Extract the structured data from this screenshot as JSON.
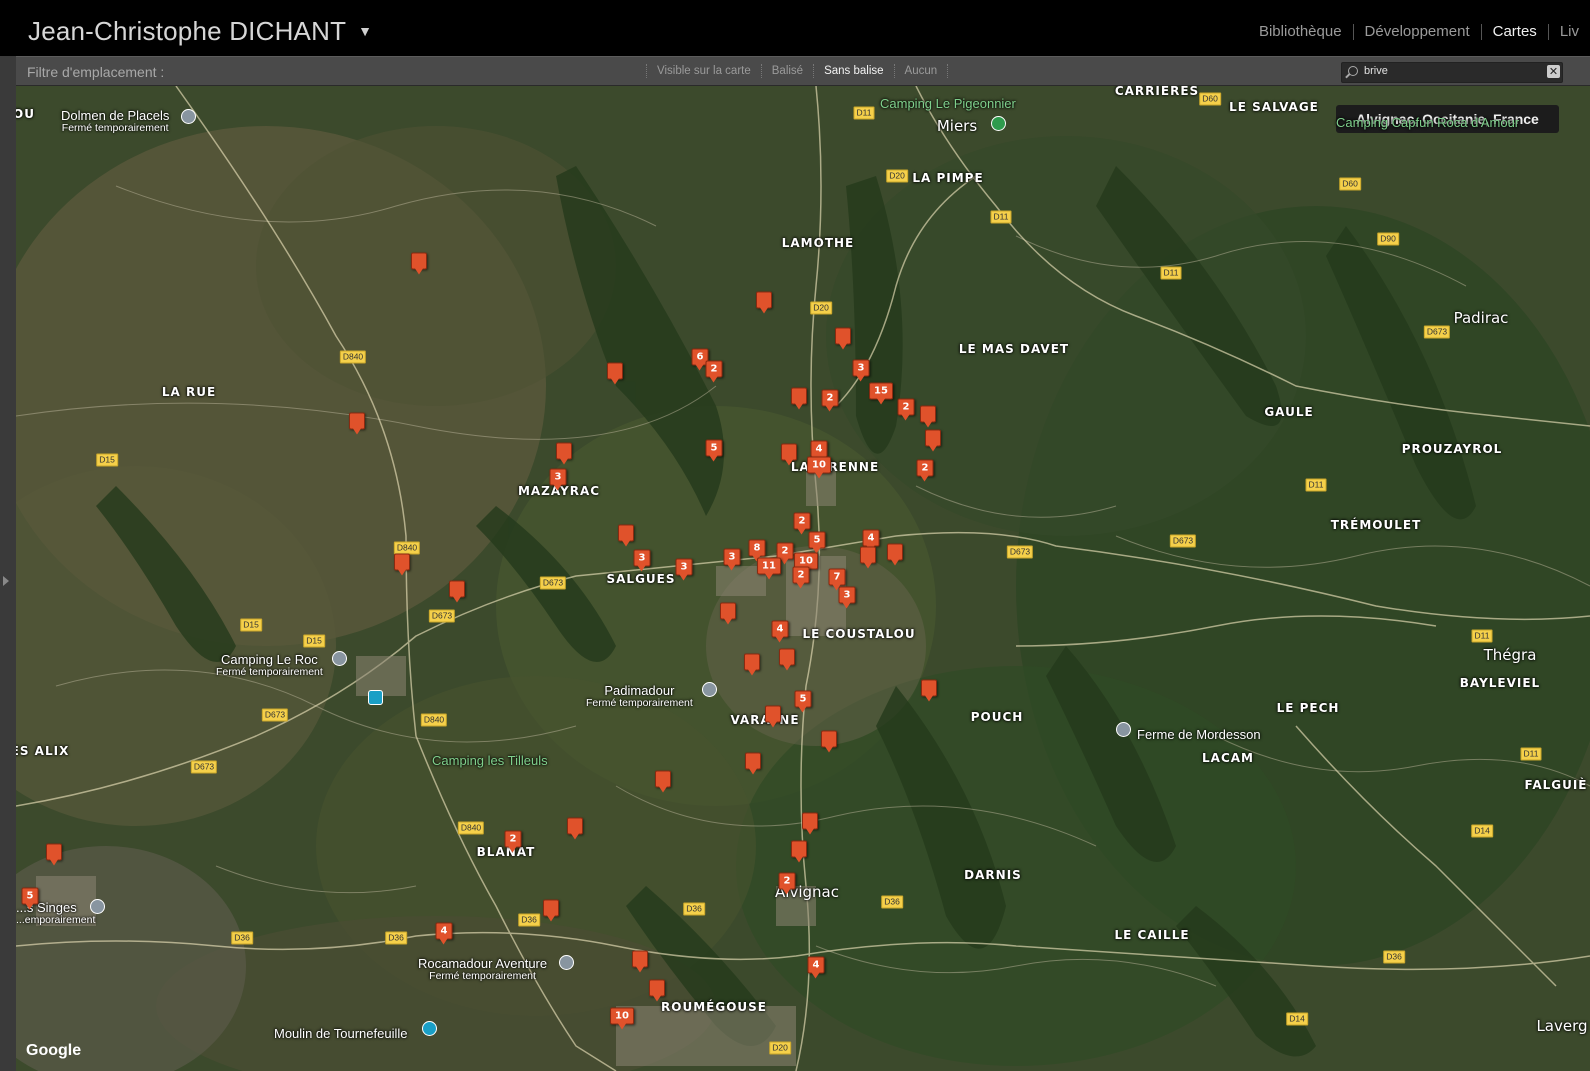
{
  "header": {
    "identity": "Jean-Christophe DICHANT",
    "modules": [
      {
        "label": "Bibliothèque",
        "active": false
      },
      {
        "label": "Développement",
        "active": false
      },
      {
        "label": "Cartes",
        "active": true
      },
      {
        "label": "Liv",
        "active": false
      }
    ]
  },
  "filter": {
    "label": "Filtre d'emplacement :",
    "options": [
      {
        "label": "Visible sur la carte",
        "selected": false
      },
      {
        "label": "Balisé",
        "selected": false
      },
      {
        "label": "Sans balise",
        "selected": true
      },
      {
        "label": "Aucun",
        "selected": false
      }
    ],
    "search_value": "brive",
    "clear_label": "✕"
  },
  "map": {
    "location_tooltip": "Alvignac, Occitanie, France",
    "attribution": "Google",
    "places": [
      "CARRIERES",
      "LE SALVAGE",
      "LA PIMPE",
      "LAMOTHE",
      "LE MAS DAVET",
      "GAULE",
      "PROUZAYROL",
      "TRÉMOULET",
      "LA RUE",
      "MAZAYRAC",
      "LAVERENNE",
      "SALGUES",
      "LE COUSTALOU",
      "VARAYNE",
      "POUCH",
      "LE PECH",
      "LACAM",
      "BAYLEVIEL",
      "FALGUIÈ",
      "ES ALIX",
      "BLANAT",
      "DARNIS",
      "LE CAILLE",
      "ROUMÉGOUSE",
      "OU"
    ],
    "towns": [
      "Miers",
      "Padirac",
      "Thégra",
      "Alvignac",
      "Laverg"
    ],
    "pois": [
      {
        "name": "Dolmen de Placels",
        "sub": "Fermé temporairement"
      },
      {
        "name": "Camping Le Pigeonnier",
        "sub": ""
      },
      {
        "name": "Camping Capfun Roca d'Amour",
        "sub": ""
      },
      {
        "name": "Camping Le Roc",
        "sub": "Fermé temporairement"
      },
      {
        "name": "Padimadour",
        "sub": "Fermé temporairement"
      },
      {
        "name": "Camping les Tilleuls",
        "sub": ""
      },
      {
        "name": "Ferme de Mordesson",
        "sub": ""
      },
      {
        "name": "...s Singes",
        "sub": "...emporairement"
      },
      {
        "name": "Rocamadour Aventure",
        "sub": "Fermé temporairement"
      },
      {
        "name": "Moulin de Tournefeuille",
        "sub": ""
      }
    ],
    "roads": [
      "D60",
      "D11",
      "D20",
      "D11",
      "D60",
      "D90",
      "D11",
      "D673",
      "D20",
      "D840",
      "D15",
      "D840",
      "D673",
      "D673",
      "D15",
      "D15",
      "D840",
      "D673",
      "D673",
      "D673",
      "D11",
      "D11",
      "D11",
      "D840",
      "D36",
      "D36",
      "D36",
      "D36",
      "D36",
      "D20",
      "D14",
      "D14",
      "D36",
      "D673"
    ],
    "pin_counts": [
      "",
      "",
      "",
      "6",
      "2",
      "3",
      "",
      "",
      "15",
      "2",
      "",
      "",
      "",
      "4",
      "10",
      "5",
      "",
      "3",
      "2",
      "",
      "2",
      "2",
      "5",
      "4",
      "",
      "8",
      "2",
      "3",
      "3",
      "11",
      "10",
      "2",
      "7",
      "3",
      "",
      "",
      "3",
      "4",
      "",
      "",
      "",
      "5",
      "",
      "",
      "",
      "",
      "",
      "",
      "",
      "",
      "2",
      "",
      "",
      "5",
      "2",
      "",
      "",
      "4",
      "",
      "10"
    ]
  }
}
